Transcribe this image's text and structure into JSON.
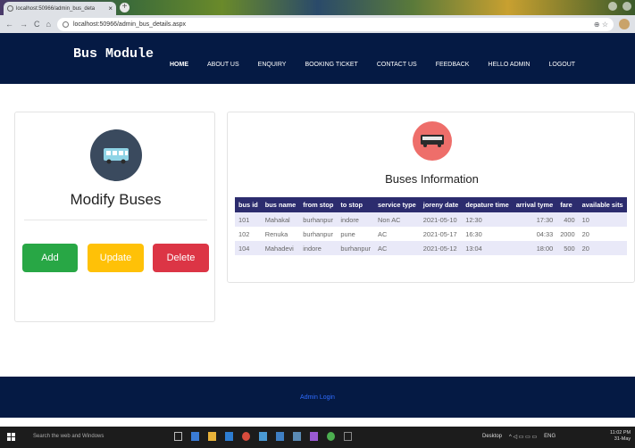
{
  "browser": {
    "tab_title": "localhost:50966/admin_bus_deta",
    "tab_close": "×",
    "new_tab": "+",
    "url": "localhost:50966/admin_bus_details.aspx",
    "url_actions": "⊕ ☆",
    "nav_back": "←",
    "nav_forward": "→",
    "nav_reload": "C",
    "nav_home": "⌂"
  },
  "nav": {
    "brand": "Bus Module",
    "items": [
      "HOME",
      "ABOUT US",
      "ENQUIRY",
      "BOOKING TICKET",
      "CONTACT US",
      "FEEDBACK",
      "HELLO ADMIN",
      "LOGOUT"
    ]
  },
  "left_panel": {
    "title": "Modify Buses",
    "add_label": "Add",
    "update_label": "Update",
    "delete_label": "Delete"
  },
  "right_panel": {
    "title": "Buses Information",
    "columns": [
      "bus id",
      "bus name",
      "from stop",
      "to stop",
      "service type",
      "joreny date",
      "depature time",
      "arrival tyme",
      "fare",
      "available sits"
    ],
    "rows": [
      [
        "101",
        "Mahakal",
        "burhanpur",
        "indore",
        "Non AC",
        "2021-05-10",
        "12:30",
        "17:30",
        "400",
        "10"
      ],
      [
        "102",
        "Renuka",
        "burhanpur",
        "pune",
        "AC",
        "2021-05-17",
        "16:30",
        "04:33",
        "2000",
        "20"
      ],
      [
        "104",
        "Mahadevi",
        "indore",
        "burhanpur",
        "AC",
        "2021-05-12",
        "13:04",
        "18:00",
        "500",
        "20"
      ]
    ]
  },
  "footer": {
    "link": "Admin Login"
  },
  "taskbar": {
    "search": "Search the web and Windows",
    "desktop": "Desktop",
    "lang": "ENG",
    "time": "11:02 PM",
    "date": "31-May"
  },
  "colors": {
    "navbar": "#051a44",
    "add": "#28a745",
    "update": "#ffc107",
    "delete": "#dc3545",
    "table_header": "#2c2c6e"
  }
}
